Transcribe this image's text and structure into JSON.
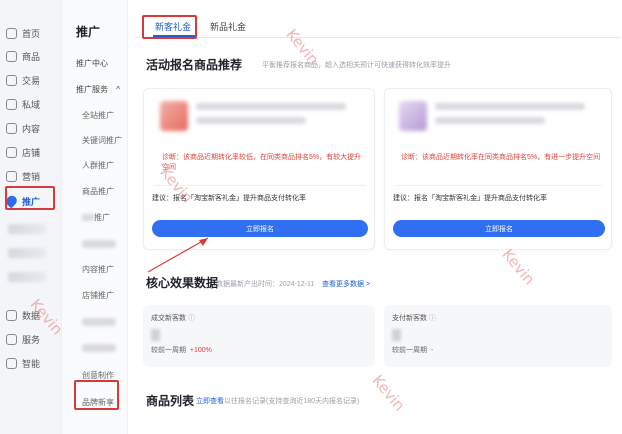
{
  "rail": {
    "items": [
      {
        "label": "首页"
      },
      {
        "label": "商品"
      },
      {
        "label": "交易"
      },
      {
        "label": "私域"
      },
      {
        "label": "内容"
      },
      {
        "label": "店铺"
      },
      {
        "label": "营销"
      },
      {
        "label": "推广"
      },
      {
        "label": "数据"
      },
      {
        "label": "服务"
      },
      {
        "label": "智能"
      }
    ]
  },
  "subnav": {
    "title": "推广",
    "items": [
      {
        "label": "推广中心"
      },
      {
        "label": "推广服务"
      },
      {
        "label": "全站推广"
      },
      {
        "label": "关键词推广"
      },
      {
        "label": "人群推广"
      },
      {
        "label": "商品推广"
      },
      {
        "label": "推广"
      },
      {
        "label": "内容推广"
      },
      {
        "label": "店铺推广"
      },
      {
        "label": "创意制作"
      },
      {
        "label": "品牌新享"
      }
    ],
    "expand_glyph": "^"
  },
  "tabs": [
    {
      "label": "新客礼金"
    },
    {
      "label": "新品礼金"
    }
  ],
  "signup": {
    "title": "活动报名商品推荐",
    "note": "平衡推荐报名商品，超入选相关预计可快速获得转化效率提升",
    "cards": [
      {
        "diagnosis": "诊断：该商品近期转化率较低，在同类商品排名5%，有较大提升空间",
        "suggestion": "建议：报名「淘宝新客礼金」提升商品支付转化率",
        "button": "立即报名"
      },
      {
        "diagnosis": "诊断：该商品近期转化率在同类商品排名5%，有进一步提升空间",
        "suggestion": "建议：报名「淘宝新客礼金」提升商品支付转化率",
        "button": "立即报名"
      }
    ]
  },
  "core": {
    "title": "核心效果数据",
    "update_note": "数据最新产出时间：2024-12-11",
    "more_link": "查看更多数据 >",
    "metrics": [
      {
        "label": "成交新客数",
        "compare_label": "较前一周期",
        "compare_value": "+100%"
      },
      {
        "label": "支付新客数",
        "compare_label": "较前一周期",
        "compare_value": "-"
      }
    ],
    "info_glyph": "ⓘ"
  },
  "products": {
    "title": "商品列表",
    "link": "立即查看",
    "note": "以往报名记录(支持查询近180天内报名记录)"
  },
  "watermark": "Kevin",
  "colors": {
    "accent": "#2f6ff0",
    "highlight": "#d73a3a",
    "warning_text": "#e0443b"
  }
}
